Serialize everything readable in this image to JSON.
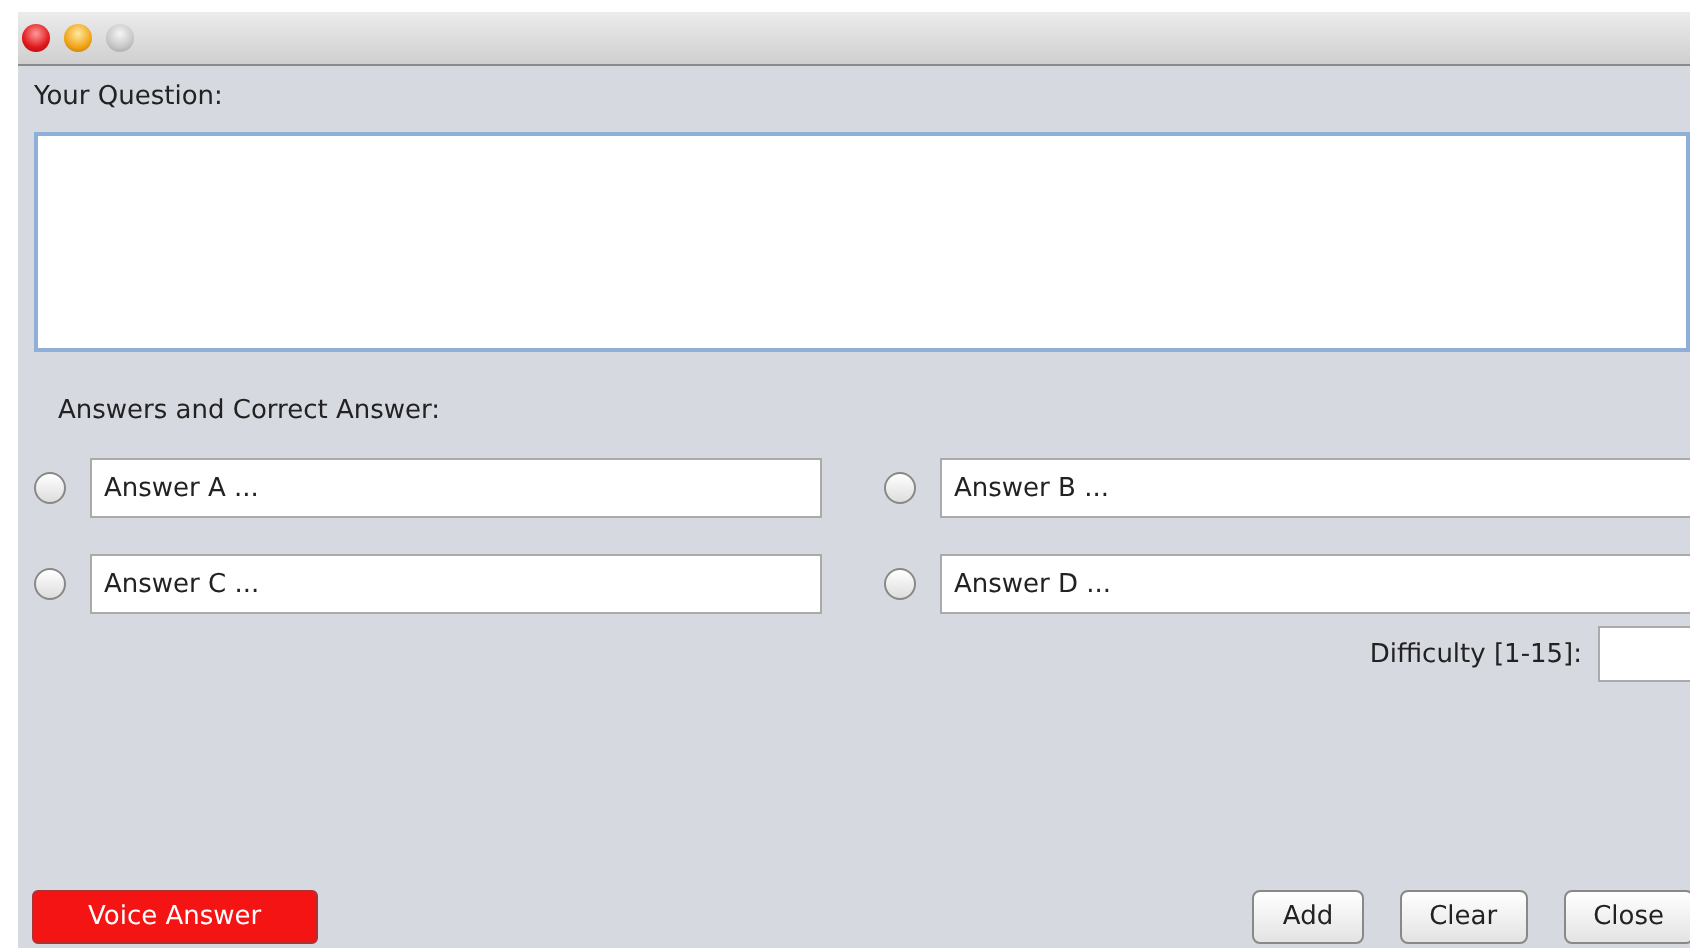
{
  "window": {
    "controls": [
      {
        "kind": "close"
      },
      {
        "kind": "minimize"
      },
      {
        "kind": "zoom"
      }
    ]
  },
  "question": {
    "label": "Your Question:"
  },
  "answers_label": "Answers and Correct Answer:",
  "answers": [
    {
      "value": "Answer A ...",
      "selected": false
    },
    {
      "value": "Answer B ...",
      "selected": false
    },
    {
      "value": "Answer C ...",
      "selected": false
    },
    {
      "value": "Answer D ...",
      "selected": false
    }
  ],
  "difficulty": {
    "label": "Difficulty [1-15]:"
  },
  "voice_button": "Voice Answer",
  "buttons": [
    "Add",
    "Clear",
    "Close"
  ]
}
